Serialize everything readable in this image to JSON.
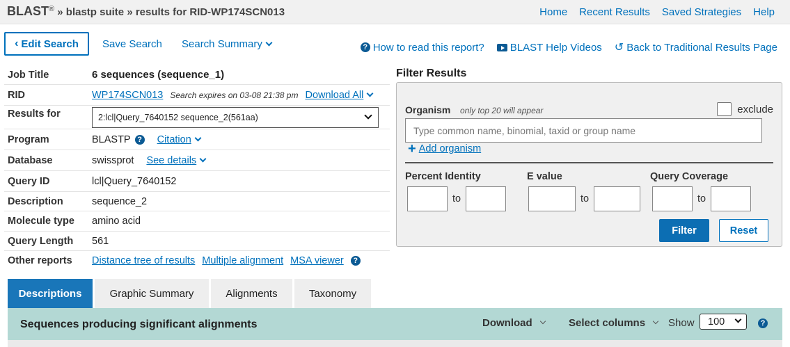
{
  "header": {
    "brand": "BLAST",
    "reg": "®",
    "crumb1": "» blastp suite",
    "crumb2": "» results for RID-WP174SCN013",
    "nav": [
      "Home",
      "Recent Results",
      "Saved Strategies",
      "Help"
    ]
  },
  "actions": {
    "edit_search": "Edit Search",
    "save_search": "Save Search",
    "search_summary": "Search Summary",
    "how_to_read": "How to read this report?",
    "help_videos": "BLAST Help Videos",
    "back_traditional": "Back to Traditional Results Page"
  },
  "job": {
    "labels": {
      "job_title": "Job Title",
      "rid": "RID",
      "results_for": "Results for",
      "program": "Program",
      "database": "Database",
      "query_id": "Query ID",
      "description": "Description",
      "molecule_type": "Molecule type",
      "query_length": "Query Length",
      "other_reports": "Other reports"
    },
    "job_title": "6 sequences (sequence_1)",
    "rid": "WP174SCN013",
    "expires": "Search expires on 03-08 21:38 pm",
    "download_all": "Download All",
    "results_for": "2:lcl|Query_7640152 sequence_2(561aa)",
    "program": "BLASTP",
    "citation": "Citation",
    "database": "swissprot",
    "see_details": "See details",
    "query_id": "lcl|Query_7640152",
    "description": "sequence_2",
    "molecule_type": "amino acid",
    "query_length": "561",
    "other_reports": [
      "Distance tree of results",
      "Multiple alignment",
      "MSA viewer"
    ]
  },
  "filter": {
    "title": "Filter Results",
    "organism_label": "Organism",
    "organism_note": "only top 20 will appear",
    "exclude": "exclude",
    "organism_placeholder": "Type common  name, binomial, taxid or group  name",
    "add_organism": "Add organism",
    "percent_identity": "Percent Identity",
    "e_value": "E value",
    "query_coverage": "Query Coverage",
    "to": "to",
    "filter_btn": "Filter",
    "reset_btn": "Reset"
  },
  "tabs": [
    "Descriptions",
    "Graphic Summary",
    "Alignments",
    "Taxonomy"
  ],
  "results": {
    "title": "Sequences producing significant alignments",
    "download": "Download",
    "select_columns": "Select columns",
    "show": "Show",
    "show_value": "100"
  },
  "colors": {
    "accent": "#0071bc",
    "tab_active": "#1976b9",
    "results_bar": "#b3d8d4"
  }
}
